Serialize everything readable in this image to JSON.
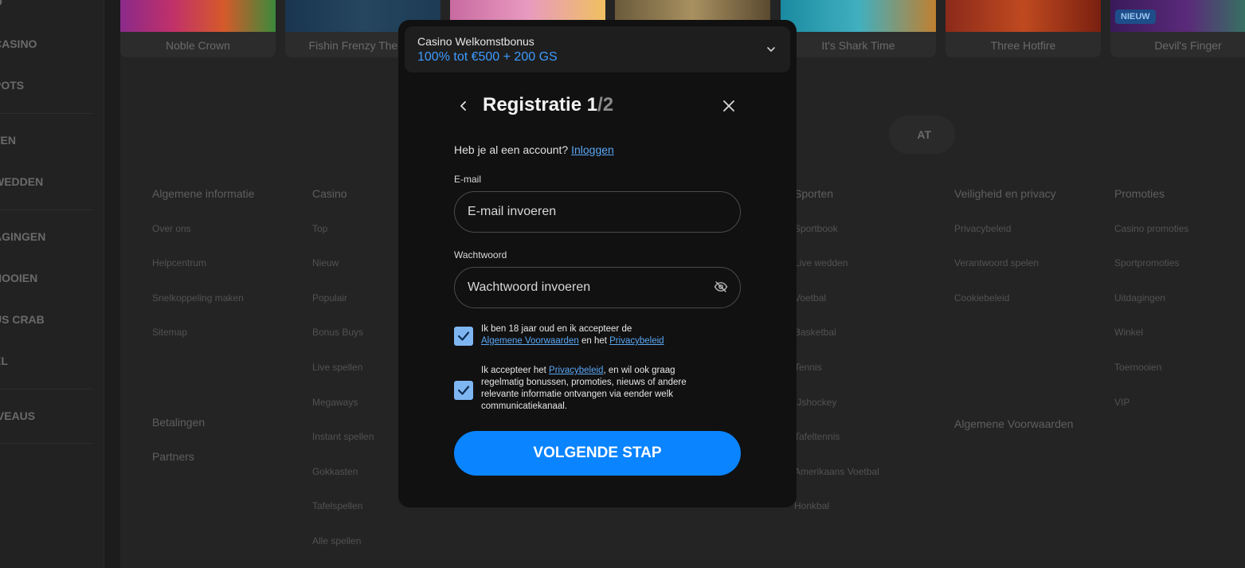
{
  "sidebar": {
    "items": [
      "CASINO",
      "POTS",
      "TEN",
      "WEDDEN",
      "AGINGEN",
      "NOOIEN",
      "US CRAB",
      "EL",
      "IVEAUS"
    ]
  },
  "games": [
    {
      "name": "Noble Crown"
    },
    {
      "name": "Fishin Frenzy The Big"
    },
    {
      "name": ""
    },
    {
      "name": ""
    },
    {
      "name": "It's Shark Time"
    },
    {
      "name": "Three Hotfire"
    },
    {
      "name": "Devil's Finger",
      "badge": "NIEUW"
    }
  ],
  "pill_button": "AT",
  "footer": {
    "col1": {
      "heading": "Algemene informatie",
      "links": [
        "Over ons",
        "Helpcentrum",
        "Snelkoppeling maken",
        "Sitemap"
      ],
      "extra": [
        "Betalingen",
        "Partners"
      ]
    },
    "col2": {
      "heading": "Casino",
      "links": [
        "Top",
        "Nieuw",
        "Populair",
        "Bonus Buys",
        "Live spellen",
        "Megaways",
        "Instant spellen",
        "Gokkasten",
        "Tafelspellen",
        "Alle spellen"
      ]
    },
    "col3": {
      "heading": "Sporten",
      "links": [
        "Sportbook",
        "Live wedden",
        "Voetbal",
        "Basketbal",
        "Tennis",
        "IJshockey",
        "Tafeltennis",
        "Amerikaans Voetbal",
        "Honkbal"
      ]
    },
    "col4": {
      "heading": "Veiligheid en privacy",
      "links": [
        "Privacybeleid",
        "Verantwoord spelen",
        "Cookiebeleid"
      ],
      "extra": [
        "Algemene Voorwaarden"
      ]
    },
    "col5": {
      "heading": "Promoties",
      "links": [
        "Casino promoties",
        "Sportpromoties",
        "Uitdagingen",
        "Winkel",
        "Toernooien",
        "VIP"
      ]
    }
  },
  "modal": {
    "bonus_title": "Casino Welkomstbonus",
    "bonus_value": "100% tot €500 + 200 GS",
    "title": "Registratie ",
    "step_current": "1",
    "step_total": "/2",
    "account_question": "Heb je al een account?",
    "login_link": "Inloggen",
    "email_label": "E-mail",
    "email_placeholder": "E-mail invoeren",
    "password_label": "Wachtwoord",
    "password_placeholder": "Wachtwoord invoeren",
    "consent1_text": "Ik ben 18 jaar oud en ik accepteer de",
    "consent1_link_terms": "Algemene Voorwaarden",
    "consent1_and": "en het",
    "consent1_link_privacy": "Privacybeleid",
    "consent2_prefix": "Ik accepteer het",
    "consent2_link": "Privacybeleid",
    "consent2_suffix": ", en wil ook graag regelmatig bonussen, promoties, nieuws of andere relevante informatie ontvangen via eender welk communicatiekanaal.",
    "next_button": "VOLGENDE STAP"
  },
  "colors": {
    "accent": "#0a84ff",
    "link": "#5aa7f5",
    "checkbox": "#7eb6f2",
    "modal_bg": "#111111"
  }
}
